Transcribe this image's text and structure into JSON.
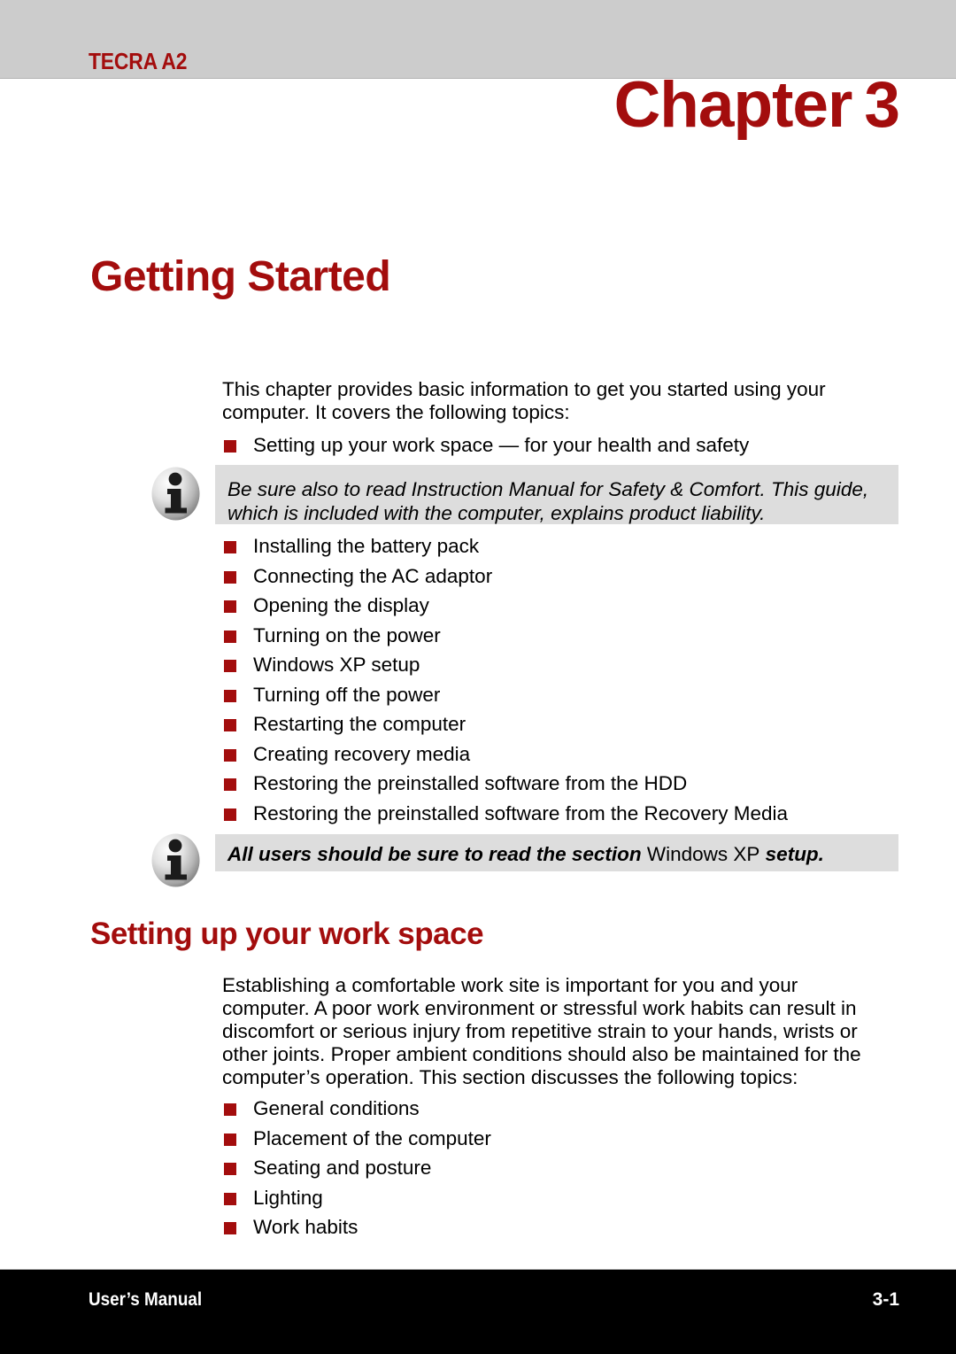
{
  "header": {
    "model": "TECRA A2",
    "chapter_label": "Chapter",
    "chapter_number": "3",
    "band_color": "#cccccc",
    "accent_color": "#a30d0d"
  },
  "page": {
    "heading": "Getting Started",
    "intro": "This chapter provides basic information to get you started using your computer. It covers the following topics:"
  },
  "topics_before_note": [
    "Setting up your work space — for your health and safety"
  ],
  "note_1": {
    "icon": "info-icon",
    "text": "Be sure also to read Instruction Manual for Safety & Comfort. This guide, which is included with the computer, explains product liability.",
    "background": "#dddddd"
  },
  "topics_after_note": [
    "Installing the battery pack",
    "Connecting the AC adaptor",
    "Opening the display",
    "Turning on the power",
    "Windows XP setup",
    "Turning off the power",
    "Restarting the computer",
    "Creating recovery media",
    "Restoring the preinstalled software from the HDD",
    "Restoring the preinstalled software from the Recovery Media"
  ],
  "note_2": {
    "icon": "info-icon",
    "text_part1": "All users should be sure to read the section ",
    "text_plain": "Windows XP",
    "text_part2": " setup.",
    "background": "#dddddd"
  },
  "section": {
    "heading": "Setting up your work space",
    "paragraph": "Establishing a comfortable work site is important for you and your computer. A poor work environment or stressful work habits can result in discomfort or serious injury from repetitive strain to your hands, wrists or other joints. Proper ambient conditions should also be maintained for the computer’s operation. This section discusses the following topics:",
    "topics": [
      "General conditions",
      "Placement of the computer",
      "Seating and posture",
      "Lighting",
      "Work habits"
    ]
  },
  "footer": {
    "left": "User’s Manual",
    "right": "3-1",
    "background": "#000000"
  }
}
